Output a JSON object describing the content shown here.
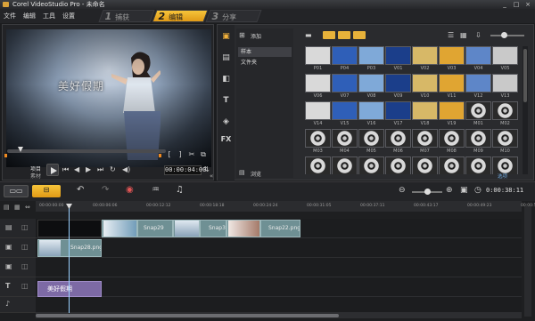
{
  "app": {
    "title": "Corel VideoStudio Pro - 未命名",
    "window_buttons": [
      "_",
      "□",
      "×"
    ]
  },
  "menu": {
    "items": [
      "文件",
      "编辑",
      "工具",
      "设置"
    ]
  },
  "steps": [
    {
      "num": "1",
      "label": "捕获"
    },
    {
      "num": "2",
      "label": "编辑"
    },
    {
      "num": "3",
      "label": "分享"
    }
  ],
  "preview": {
    "caption": "美好假期",
    "mode_project": "项目",
    "mode_clip": "素材",
    "timecode": "00:00:04:00",
    "trim_start": "[",
    "trim_end": "]"
  },
  "library": {
    "add_label": "添加",
    "folders": [
      "样本",
      "文件夹"
    ],
    "browse_label": "浏览",
    "sidebar_icons": [
      "media",
      "instant-project",
      "transition",
      "title",
      "graphic",
      "fx"
    ],
    "thumbnails": [
      [
        "P01",
        "P04",
        "P03",
        "V01",
        "V02",
        "V03",
        "V04",
        "V05"
      ],
      [
        "V06",
        "V07",
        "V08",
        "V09",
        "V10",
        "V11",
        "V12",
        "V13"
      ],
      [
        "V14",
        "V15",
        "V16",
        "V17",
        "V18",
        "V19",
        "M01",
        "M02"
      ],
      [
        "M03",
        "M04",
        "M05",
        "M06",
        "M07",
        "M08",
        "M09",
        "M10"
      ],
      [
        "M11",
        "M12",
        "M13",
        "M14",
        "M15",
        "M16",
        "M17",
        "M18"
      ]
    ],
    "info_label": "选项"
  },
  "timeline": {
    "end_timecode": "0:00:38:11",
    "ruler": [
      "00:00:00:00",
      "00:00:06:06",
      "00:00:12:12",
      "00:00:18:18",
      "00:00:24:24",
      "00:00:31:05",
      "00:00:37:11",
      "00:00:43:17",
      "00:00:49:23",
      "00:00:56:04"
    ],
    "video_clips": [
      "Snap29",
      "Snap31",
      "Snap22.png"
    ],
    "overlay_clip": "Snap28.png",
    "title_clip": "美好假期"
  }
}
